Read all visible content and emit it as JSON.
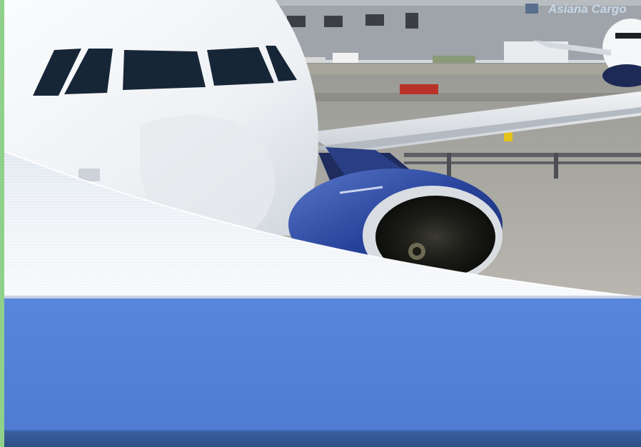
{
  "hero": {
    "signage_text": "Asiana Cargo",
    "image_subject": "airliner-nose-and-engine-on-tarmac"
  },
  "colors": {
    "left_rail": "#8fd08a",
    "blue_panel": "#5886db",
    "footer_bar": "#34568f",
    "swoosh_light": "#eef2f7",
    "engine_blue": "#27429a"
  }
}
